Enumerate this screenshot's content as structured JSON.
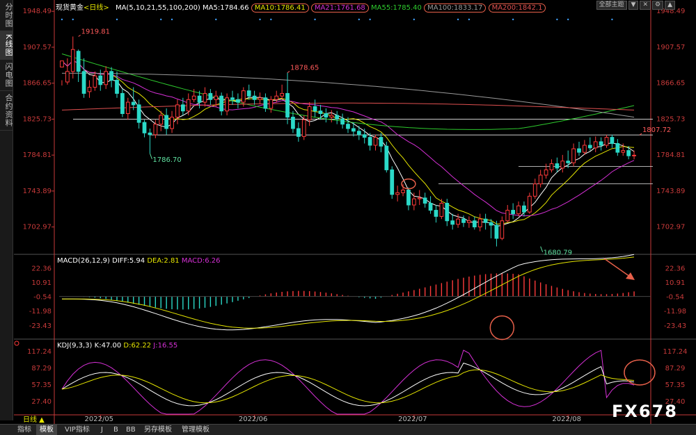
{
  "sidebar": {
    "tabs": [
      {
        "label": "分时图",
        "active": false
      },
      {
        "label": "K线图",
        "active": true
      },
      {
        "label": "闪电图",
        "active": false
      },
      {
        "label": "合约资料",
        "active": false
      }
    ]
  },
  "header": {
    "symbol": "现货黄金",
    "period": "<日线>",
    "ma_params": "MA(5,10,21,55,100,200)",
    "ma5": "MA5:1784.66",
    "ma10": "MA10:1786.41",
    "ma21": "MA21:1761.68",
    "ma55": "MA55:1785.40",
    "ma100": "MA100:1833.17",
    "ma200": "MA200:1842.1",
    "controls": [
      "全部主题",
      "▼",
      "✕",
      "⚙",
      "▲"
    ]
  },
  "macd_header": {
    "params": "MACD(26,12,9)",
    "diff": "DIFF:5.94",
    "dea": "DEA:2.81",
    "macd": "MACD:6.26"
  },
  "kdj_header": {
    "params": "KDJ(9,3,3)",
    "k": "K:47.00",
    "d": "D:62.22",
    "j": "J:16.55"
  },
  "bottom_bar": {
    "period_label": "日线 ▲",
    "tabs": [
      "指标",
      "模板",
      "VIP指标",
      "J",
      "B",
      "BB",
      "另存模板",
      "管理模板"
    ],
    "active_tab": "模板"
  },
  "watermark": "FX678",
  "colors": {
    "up": "#ff3b3b",
    "down": "#2bd9c8",
    "ma5": "#ffffff",
    "ma10": "#e6e600",
    "ma21": "#d630d6",
    "ma55": "#2ecc2e",
    "ma100": "#9a9a9a",
    "ma200": "#e05050",
    "axis": "#c83a3a",
    "annotation": "#e8604a"
  },
  "chart_data": [
    {
      "type": "candlestick",
      "title": "现货黄金 日线",
      "y_ticks": [
        1948.49,
        1907.57,
        1866.65,
        1825.73,
        1784.81,
        1743.89,
        1702.97
      ],
      "ylim": [
        1675,
        1955
      ],
      "x_ticks": [
        "2022/05",
        "2022/06",
        "2022/07",
        "2022/08"
      ],
      "x_tick_index": [
        7,
        35,
        64,
        92
      ],
      "annotations": [
        {
          "label": "1919.81",
          "index": 3,
          "value": 1919.81
        },
        {
          "label": "1878.65",
          "index": 41,
          "value": 1878.65
        },
        {
          "label": "1786.70",
          "index": 16,
          "value": 1786.7
        },
        {
          "label": "1680.79",
          "index": 87,
          "value": 1680.79
        },
        {
          "label": "1807.72",
          "index": 105,
          "value": 1807.72
        }
      ],
      "horizontal_lines": [
        1825.73,
        1807.72,
        1772.0,
        1752.0
      ],
      "candles": [
        [
          1885,
          1892,
          1870,
          1864
        ],
        [
          1868,
          1880,
          1895,
          1865
        ],
        [
          1880,
          1905,
          1919.81,
          1872
        ],
        [
          1903,
          1880,
          1905,
          1868
        ],
        [
          1880,
          1855,
          1895,
          1850
        ],
        [
          1857,
          1862,
          1870,
          1850
        ],
        [
          1862,
          1875,
          1880,
          1858
        ],
        [
          1875,
          1865,
          1882,
          1858
        ],
        [
          1865,
          1880,
          1886,
          1860
        ],
        [
          1880,
          1870,
          1885,
          1862
        ],
        [
          1870,
          1855,
          1880,
          1850
        ],
        [
          1855,
          1832,
          1860,
          1828
        ],
        [
          1832,
          1845,
          1850,
          1825
        ],
        [
          1845,
          1842,
          1862,
          1836
        ],
        [
          1842,
          1822,
          1848,
          1815
        ],
        [
          1822,
          1810,
          1825,
          1805
        ],
        [
          1810,
          1808,
          1815,
          1786.7
        ],
        [
          1808,
          1820,
          1825,
          1804
        ],
        [
          1820,
          1830,
          1835,
          1812
        ],
        [
          1830,
          1815,
          1838,
          1808
        ],
        [
          1815,
          1828,
          1835,
          1810
        ],
        [
          1828,
          1842,
          1848,
          1820
        ],
        [
          1842,
          1835,
          1850,
          1830
        ],
        [
          1835,
          1848,
          1855,
          1830
        ],
        [
          1848,
          1852,
          1860,
          1845
        ],
        [
          1852,
          1845,
          1858,
          1838
        ],
        [
          1845,
          1855,
          1862,
          1840
        ],
        [
          1855,
          1848,
          1860,
          1842
        ],
        [
          1848,
          1852,
          1858,
          1840
        ],
        [
          1852,
          1835,
          1856,
          1830
        ],
        [
          1835,
          1850,
          1855,
          1830
        ],
        [
          1850,
          1848,
          1858,
          1842
        ],
        [
          1848,
          1845,
          1855,
          1838
        ],
        [
          1845,
          1858,
          1862,
          1840
        ],
        [
          1858,
          1852,
          1865,
          1848
        ],
        [
          1852,
          1848,
          1858,
          1842
        ],
        [
          1848,
          1850,
          1856,
          1843
        ],
        [
          1850,
          1838,
          1855,
          1834
        ],
        [
          1838,
          1848,
          1852,
          1833
        ],
        [
          1848,
          1852,
          1858,
          1845
        ],
        [
          1852,
          1855,
          1865,
          1848
        ],
        [
          1855,
          1828,
          1878.65,
          1820
        ],
        [
          1828,
          1815,
          1835,
          1810
        ],
        [
          1815,
          1806,
          1822,
          1800
        ],
        [
          1806,
          1825,
          1830,
          1802
        ],
        [
          1825,
          1840,
          1845,
          1818
        ],
        [
          1840,
          1835,
          1848,
          1828
        ],
        [
          1835,
          1832,
          1842,
          1825
        ],
        [
          1832,
          1828,
          1838,
          1822
        ],
        [
          1828,
          1830,
          1836,
          1822
        ],
        [
          1830,
          1826,
          1835,
          1820
        ],
        [
          1826,
          1820,
          1832,
          1815
        ],
        [
          1820,
          1815,
          1828,
          1810
        ],
        [
          1815,
          1812,
          1822,
          1806
        ],
        [
          1812,
          1808,
          1818,
          1802
        ],
        [
          1808,
          1805,
          1815,
          1798
        ],
        [
          1805,
          1796,
          1810,
          1790
        ],
        [
          1796,
          1805,
          1808,
          1790
        ],
        [
          1805,
          1795,
          1810,
          1788
        ],
        [
          1795,
          1768,
          1800,
          1765
        ],
        [
          1768,
          1740,
          1772,
          1735
        ],
        [
          1740,
          1742,
          1750,
          1732
        ],
        [
          1742,
          1745,
          1752,
          1738
        ],
        [
          1745,
          1728,
          1748,
          1722
        ],
        [
          1728,
          1735,
          1742,
          1722
        ],
        [
          1735,
          1736,
          1745,
          1728
        ],
        [
          1736,
          1730,
          1742,
          1725
        ],
        [
          1730,
          1722,
          1738,
          1718
        ],
        [
          1722,
          1715,
          1728,
          1708
        ],
        [
          1715,
          1730,
          1735,
          1712
        ],
        [
          1730,
          1710,
          1735,
          1704
        ],
        [
          1710,
          1706,
          1718,
          1700
        ],
        [
          1706,
          1712,
          1718,
          1702
        ],
        [
          1712,
          1708,
          1716,
          1703
        ],
        [
          1708,
          1710,
          1715,
          1702
        ],
        [
          1710,
          1703,
          1715,
          1700
        ],
        [
          1703,
          1712,
          1718,
          1698
        ],
        [
          1712,
          1708,
          1718,
          1700
        ],
        [
          1708,
          1705,
          1712,
          1690
        ],
        [
          1705,
          1690,
          1710,
          1680.79
        ],
        [
          1690,
          1710,
          1715,
          1688
        ],
        [
          1710,
          1722,
          1728,
          1708
        ],
        [
          1722,
          1718,
          1730,
          1712
        ],
        [
          1718,
          1727,
          1732,
          1715
        ],
        [
          1727,
          1720,
          1732,
          1715
        ],
        [
          1720,
          1738,
          1742,
          1718
        ],
        [
          1738,
          1752,
          1758,
          1735
        ],
        [
          1752,
          1762,
          1768,
          1748
        ],
        [
          1762,
          1768,
          1775,
          1758
        ],
        [
          1768,
          1775,
          1780,
          1765
        ],
        [
          1775,
          1770,
          1782,
          1765
        ],
        [
          1770,
          1778,
          1785,
          1765
        ],
        [
          1778,
          1776,
          1790,
          1770
        ],
        [
          1776,
          1792,
          1798,
          1772
        ],
        [
          1792,
          1788,
          1800,
          1784
        ],
        [
          1788,
          1796,
          1802,
          1785
        ],
        [
          1796,
          1793,
          1805,
          1790
        ],
        [
          1793,
          1800,
          1806,
          1788
        ],
        [
          1800,
          1796,
          1805,
          1790
        ],
        [
          1796,
          1805,
          1807.72,
          1793
        ],
        [
          1805,
          1798,
          1808,
          1793
        ],
        [
          1798,
          1788,
          1803,
          1784
        ],
        [
          1788,
          1790,
          1798,
          1784
        ],
        [
          1790,
          1784,
          1795,
          1780
        ],
        [
          1784,
          1784.66,
          1790,
          1780
        ]
      ]
    },
    {
      "type": "bar",
      "title": "MACD(26,12,9)",
      "y_ticks": [
        22.36,
        10.91,
        -0.54,
        -11.98,
        -23.43
      ],
      "ylim": [
        -33,
        27
      ],
      "series": [
        {
          "name": "DIFF",
          "color": "#ffffff"
        },
        {
          "name": "DEA",
          "color": "#e6e600"
        },
        {
          "name": "MACD",
          "color": "#d630d6"
        }
      ]
    },
    {
      "type": "line",
      "title": "KDJ(9,3,3)",
      "y_ticks": [
        117.24,
        87.29,
        57.35,
        27.4
      ],
      "ylim": [
        5,
        125
      ],
      "series": [
        {
          "name": "K",
          "color": "#ffffff"
        },
        {
          "name": "D",
          "color": "#e6e600"
        },
        {
          "name": "J",
          "color": "#d630d6"
        }
      ]
    }
  ]
}
